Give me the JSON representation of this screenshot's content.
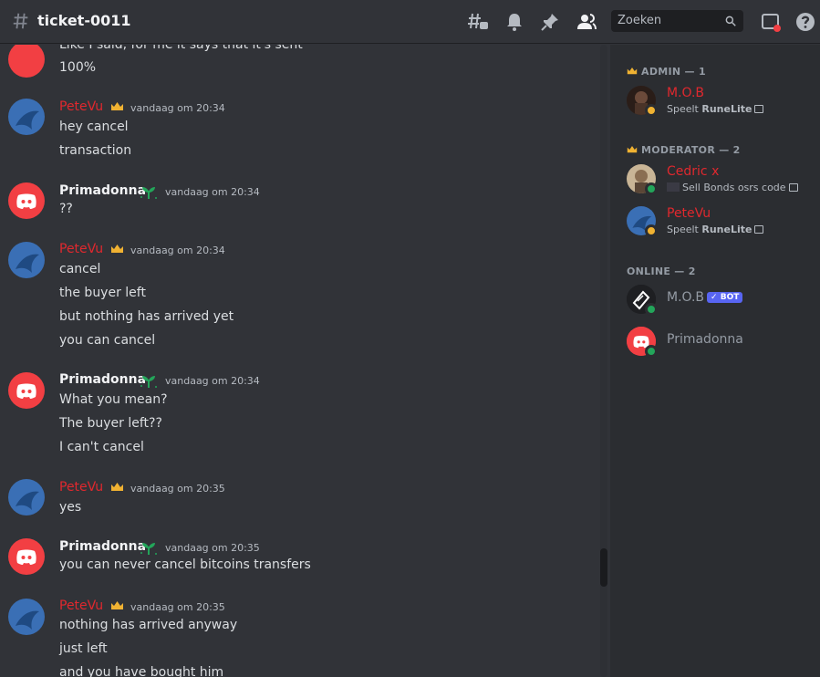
{
  "header": {
    "channel": "ticket-0011",
    "search_placeholder": "Zoeken"
  },
  "messages": [
    {
      "user": "",
      "lines": [
        "Like I said, for me it says that it's sent",
        "100%"
      ]
    },
    {
      "user": "PeteVu",
      "time": "vandaag om 20:34",
      "lines": [
        "hey cancel",
        "transaction"
      ]
    },
    {
      "user": "Primadonna",
      "time": "vandaag om 20:34",
      "lines": [
        "??"
      ]
    },
    {
      "user": "PeteVu",
      "time": "vandaag om 20:34",
      "lines": [
        "cancel",
        "the buyer left",
        "but nothing has arrived yet",
        "you can cancel"
      ]
    },
    {
      "user": "Primadonna",
      "time": "vandaag om 20:34",
      "lines": [
        "What you mean?",
        "The buyer left??",
        "I can't cancel"
      ]
    },
    {
      "user": "PeteVu",
      "time": "vandaag om 20:35",
      "lines": [
        "yes"
      ]
    },
    {
      "user": "Primadonna",
      "time": "vandaag om 20:35",
      "lines": [
        "you can never cancel bitcoins transfers"
      ]
    },
    {
      "user": "PeteVu",
      "time": "vandaag om 20:35",
      "lines": [
        "nothing has arrived anyway",
        "just left",
        "and you have bought him"
      ]
    }
  ],
  "members": {
    "admin_header": "ADMIN — 1",
    "moderator_header": "MODERATOR — 2",
    "online_header": "ONLINE — 2",
    "admin": [
      {
        "name": "M.O.B",
        "activity_prefix": "Speelt ",
        "activity": "RuneLite"
      }
    ],
    "moderator": [
      {
        "name": "Cedric x",
        "activity": "Sell Bonds osrs code"
      },
      {
        "name": "PeteVu",
        "activity_prefix": "Speelt ",
        "activity": "RuneLite"
      }
    ],
    "online": [
      {
        "name": "M.O.B",
        "badge": "BOT"
      },
      {
        "name": "Primadonna"
      }
    ]
  },
  "colors": {
    "accent_red": "#e0282e",
    "online_green": "#23a55a",
    "idle_yellow": "#f0b232",
    "bot_blue": "#5865f2"
  }
}
